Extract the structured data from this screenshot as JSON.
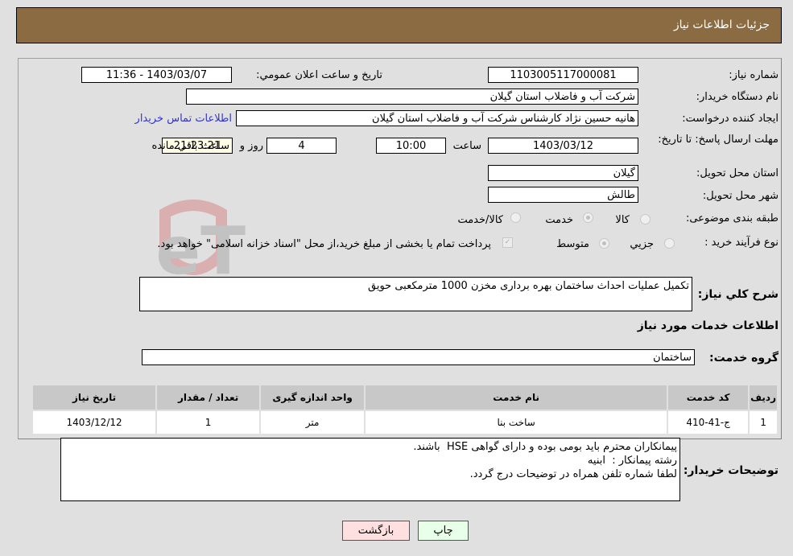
{
  "header": {
    "title": "جزئیات اطلاعات نیاز"
  },
  "fields": {
    "need_number_label": "شماره نیاز:",
    "need_number": "1103005117000081",
    "announce_label": "تاریخ و ساعت اعلان عمومي:",
    "announce_value": "1403/03/07 - 11:36",
    "buyer_org_label": "نام دستگاه خریدار:",
    "buyer_org": "شرکت آب و فاضلاب استان گیلان",
    "creator_label": "ایجاد کننده درخواست:",
    "creator": "هانیه حسین نژاد کارشناس شرکت آب و فاضلاب استان گیلان",
    "contact_link": "اطلاعات تماس خریدار",
    "deadline_label": "مهلت ارسال پاسخ: تا تاریخ:",
    "deadline_date": "1403/03/12",
    "time_label": "ساعت",
    "deadline_time": "10:00",
    "days_value": "4",
    "days_label": "روز و",
    "remaining_time": "21:23:21",
    "remaining_label": "ساعت باقي مانده",
    "province_label": "استان محل تحویل:",
    "province": "گیلان",
    "city_label": "شهر محل تحویل:",
    "city": "طالش",
    "category_label": "طبقه بندی موضوعی:",
    "category_options": [
      {
        "label": "کالا",
        "selected": false
      },
      {
        "label": "خدمت",
        "selected": true
      },
      {
        "label": "کالا/خدمت",
        "selected": false
      }
    ],
    "process_label": "نوع فرآیند خرید :",
    "process_options": [
      {
        "label": "جزيي",
        "selected": false
      },
      {
        "label": "متوسط",
        "selected": true
      }
    ],
    "treasury_note": "پرداخت تمام یا بخشی از مبلغ خرید،از محل \"اسناد خزانه اسلامی\" خواهد بود."
  },
  "description": {
    "label": "شرح کلي نیاز:",
    "value": "تکمیل عملیات احداث ساختمان بهره برداری مخزن 1000 مترمکعبی حویق"
  },
  "services_section": {
    "title": "اطلاعات خدمات مورد نیاز",
    "group_label": "گروه خدمت:",
    "group_value": "ساختمان"
  },
  "table": {
    "headers": [
      "ردیف",
      "کد خدمت",
      "نام خدمت",
      "واحد اندازه گیری",
      "تعداد / مقدار",
      "تاریخ نیاز"
    ],
    "rows": [
      [
        "1",
        "ج-41-410",
        "ساخت بنا",
        "متر",
        "1",
        "1403/12/12"
      ]
    ]
  },
  "buyer_notes": {
    "label": "توضیحات خریدار:",
    "value": "پیمانکاران محترم باید بومی بوده و دارای گواهی HSE  باشند.\nرشته پیمانکار :  ابنیه\nلطفا شماره تلفن همراه در توضیحات درج گردد."
  },
  "buttons": {
    "print": "چاپ",
    "back": "بازگشت"
  },
  "watermark": "AriaTender.neT"
}
